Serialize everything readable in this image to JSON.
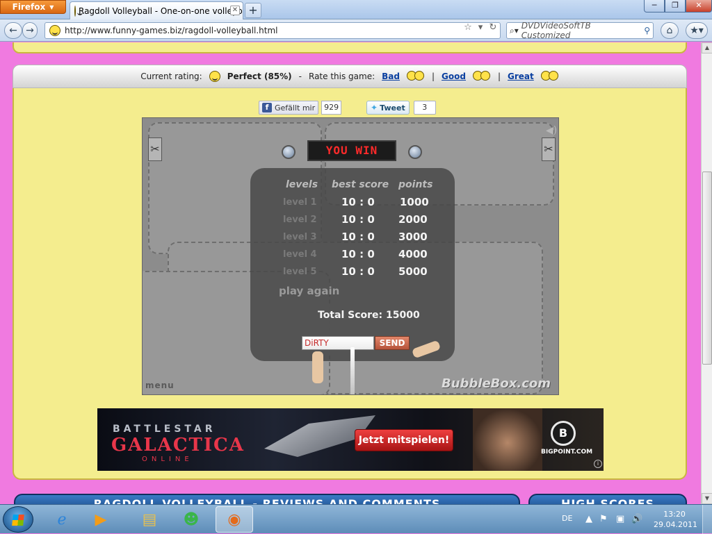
{
  "browser": {
    "menu_label": "Firefox",
    "tab_title": "Ragdoll Volleyball - One-on-one volleyb...",
    "url": "http://www.funny-games.biz/ragdoll-volleyball.html",
    "search_placeholder": "DVDVideoSoftTB Customized"
  },
  "rating": {
    "current_label": "Current rating:",
    "current_value": "Perfect (85%)",
    "separator": "-",
    "rate_label": "Rate this game:",
    "options": [
      "Bad",
      "Good",
      "Great"
    ],
    "divider": "|"
  },
  "social": {
    "fb_label": "Gefällt mir",
    "fb_count": "929",
    "tweet_label": "Tweet",
    "tweet_count": "3"
  },
  "game": {
    "banner": "YOU WIN",
    "headers": [
      "levels",
      "best score",
      "points"
    ],
    "rows": [
      {
        "level": "level 1",
        "score": "10 : 0",
        "points": "1000"
      },
      {
        "level": "level 2",
        "score": "10 : 0",
        "points": "2000"
      },
      {
        "level": "level 3",
        "score": "10 : 0",
        "points": "3000"
      },
      {
        "level": "level 4",
        "score": "10 : 0",
        "points": "4000"
      },
      {
        "level": "level 5",
        "score": "10 : 0",
        "points": "5000"
      }
    ],
    "play_again": "play again",
    "total_label": "Total Score: 15000",
    "name_value": "DiRTY",
    "send_label": "SEND",
    "menu_label": "menu",
    "logo": "BubbleBox.com"
  },
  "ad": {
    "battlestar": "BATTLESTAR",
    "galactica": "GALACTICA",
    "online": "ONLINE",
    "cta": "Jetzt mitspielen!",
    "brand": "BIGPOINT.COM",
    "info": "i"
  },
  "sections": {
    "reviews": "RAGDOLL VOLLEYBALL - REVIEWS AND COMMENTS",
    "high_scores": "HIGH SCORES"
  },
  "taskbar": {
    "language": "DE",
    "time": "13:20",
    "date": "29.04.2011"
  }
}
